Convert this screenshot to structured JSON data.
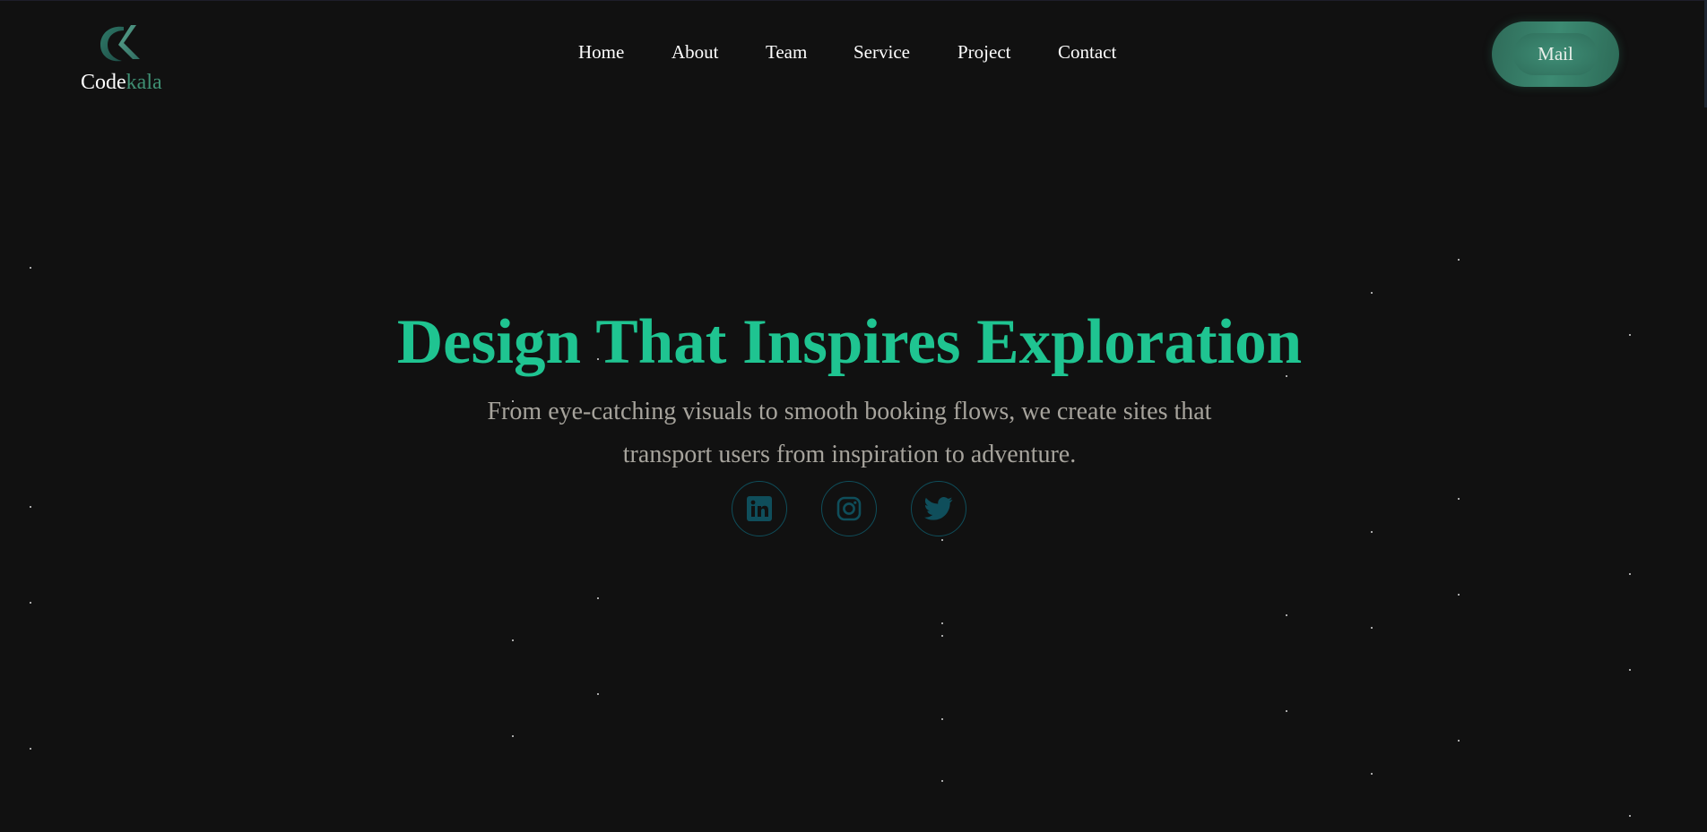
{
  "brand": {
    "name_part1": "Code",
    "name_part2": "kala",
    "accent_color": "#3f8f73",
    "logo_icon": "ck-monogram-icon"
  },
  "nav": {
    "items": [
      {
        "label": "Home"
      },
      {
        "label": "About"
      },
      {
        "label": "Team"
      },
      {
        "label": "Service"
      },
      {
        "label": "Project"
      },
      {
        "label": "Contact"
      }
    ]
  },
  "header": {
    "mail_label": "Mail"
  },
  "hero": {
    "title": "Design That Inspires Exploration",
    "subtitle_line1": "From eye-catching visuals to smooth booking flows, we create sites that",
    "subtitle_line2": "transport users from inspiration to adventure.",
    "title_color": "#1fc491",
    "subtitle_color": "#a6a39c"
  },
  "social": {
    "links": [
      {
        "icon": "linkedin-icon"
      },
      {
        "icon": "instagram-icon"
      },
      {
        "icon": "twitter-icon"
      }
    ],
    "icon_color": "#0f4e5b"
  },
  "colors": {
    "background": "#111111"
  }
}
